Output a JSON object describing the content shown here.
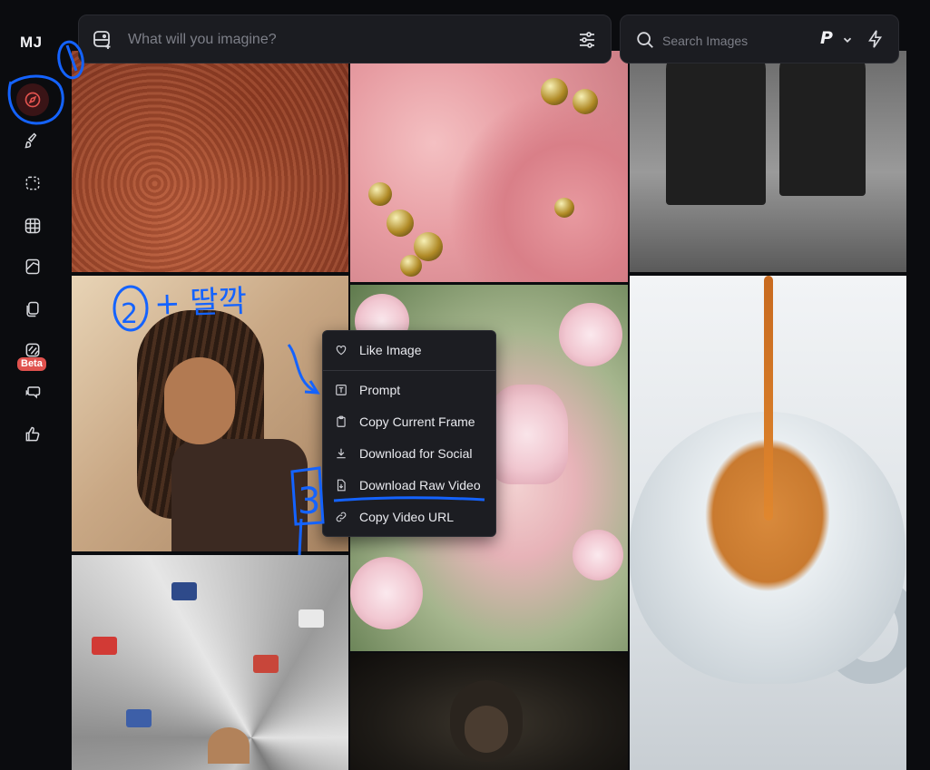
{
  "app": {
    "logo": "MJ"
  },
  "sidebar": {
    "beta_label": "Beta",
    "items": [
      {
        "name": "explore",
        "icon": "compass-icon",
        "active": true
      },
      {
        "name": "create",
        "icon": "brush-icon",
        "active": false
      },
      {
        "name": "edit",
        "icon": "edit-frame-icon",
        "active": false
      },
      {
        "name": "organize",
        "icon": "grid-icon",
        "active": false
      },
      {
        "name": "personalize",
        "icon": "palette-icon",
        "active": false
      },
      {
        "name": "moodboards",
        "icon": "copy-icon",
        "active": false
      },
      {
        "name": "video",
        "icon": "video-beta-icon",
        "active": false
      },
      {
        "name": "chat",
        "icon": "chat-icon",
        "active": false
      },
      {
        "name": "rank",
        "icon": "thumbs-up-icon",
        "active": false
      }
    ]
  },
  "prompt_bar": {
    "placeholder": "What will you imagine?"
  },
  "search_bar": {
    "placeholder": "Search Images",
    "mode_label": "P"
  },
  "context_menu": {
    "items": [
      {
        "label": "Like Image",
        "icon": "heart-icon"
      },
      {
        "label": "Prompt",
        "icon": "text-icon"
      },
      {
        "label": "Copy Current Frame",
        "icon": "clipboard-icon"
      },
      {
        "label": "Download for Social",
        "icon": "download-icon"
      },
      {
        "label": "Download Raw Video",
        "icon": "download-file-icon"
      },
      {
        "label": "Copy Video URL",
        "icon": "link-icon"
      }
    ]
  },
  "annotations": {
    "step_1": "1",
    "step_2": "2",
    "step_2_note": "+ 딸깍",
    "step_3": "3",
    "color": "#1463ff"
  },
  "colors": {
    "accent": "#e0524e",
    "background": "#0b0c0f",
    "panel": "#1b1c21"
  }
}
